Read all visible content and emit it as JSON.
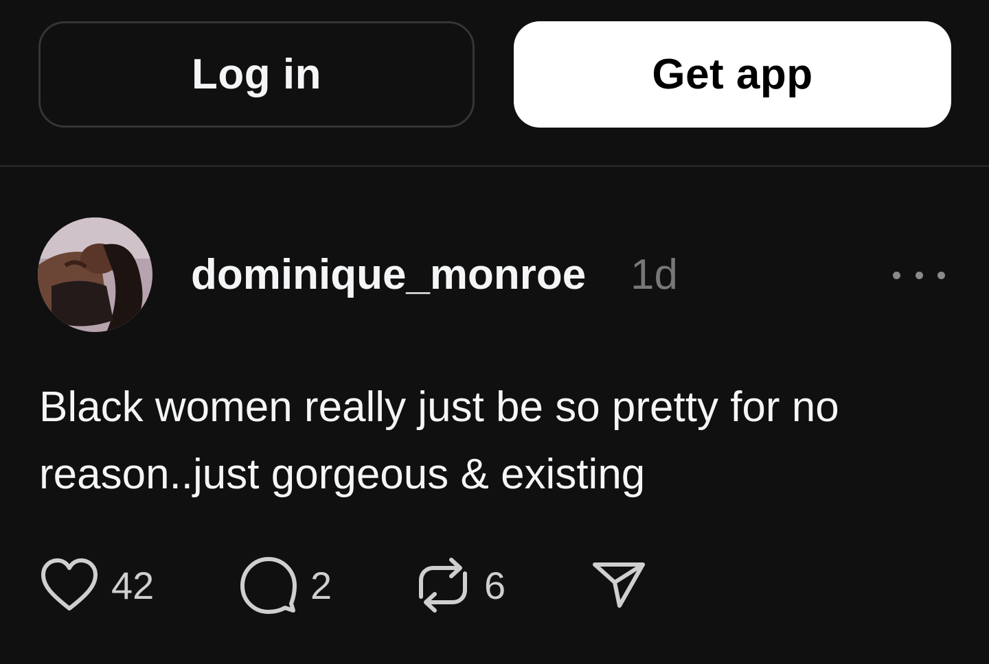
{
  "header": {
    "login_label": "Log in",
    "getapp_label": "Get app"
  },
  "post": {
    "username": "dominique_monroe",
    "time_ago": "1d",
    "text": "Black women really just be so pretty for no reason..just gorgeous & existing",
    "likes": "42",
    "replies": "2",
    "reposts": "6"
  },
  "icons": {
    "like": "heart-icon",
    "reply": "comment-icon",
    "repost": "repost-icon",
    "share": "send-icon",
    "more": "more-icon"
  },
  "colors": {
    "background": "#101010",
    "text_primary": "#f3f5f7",
    "text_secondary": "#777777",
    "button_primary_bg": "#ffffff",
    "button_outline": "#333638"
  }
}
